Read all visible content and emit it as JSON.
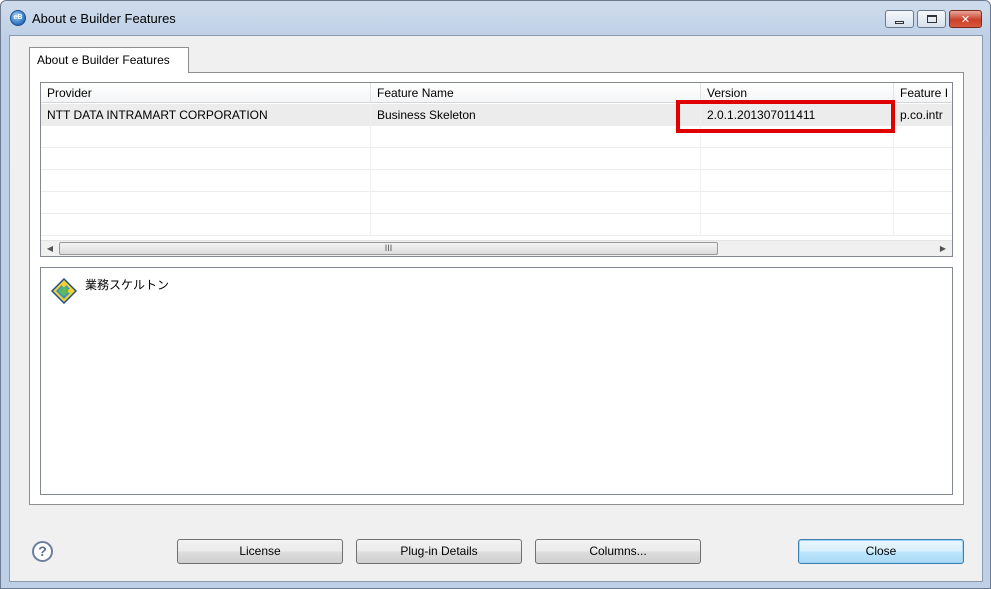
{
  "window": {
    "title": "About e Builder Features",
    "app_icon_text": "eB"
  },
  "tab": {
    "label": "About e Builder Features"
  },
  "table": {
    "columns": [
      "Provider",
      "Feature Name",
      "Version",
      "Feature I"
    ],
    "rows": [
      [
        "NTT DATA INTRAMART CORPORATION",
        "Business Skeleton",
        "2.0.1.201307011411",
        "p.co.intr"
      ]
    ],
    "scroll_thumb_label": "III"
  },
  "description": {
    "text": "業務スケルトン"
  },
  "buttons": {
    "license": "License",
    "plugin_details": "Plug-in Details",
    "columns": "Columns...",
    "close": "Close"
  },
  "help_icon_text": "?",
  "colors": {
    "highlight": "#e00000",
    "window_frame": "#bfd0e6"
  }
}
